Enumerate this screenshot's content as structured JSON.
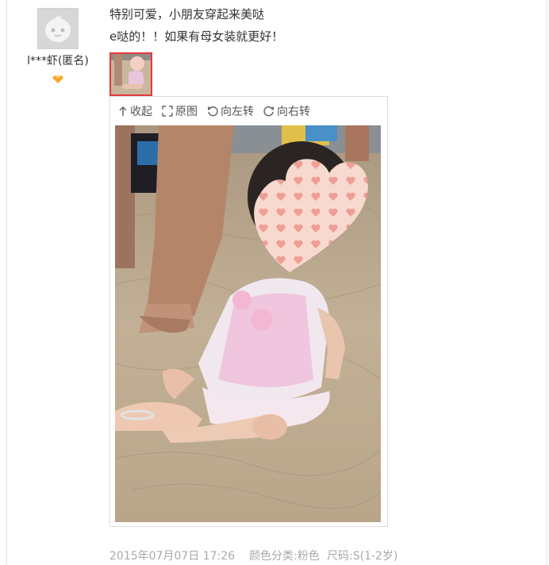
{
  "reviewer": {
    "name": "l***虾(匿名)",
    "level_icon": "diamond-icon",
    "level_color": "#f5a623"
  },
  "review": {
    "line1": "特别可爱，小朋友穿起来美哒",
    "line2": "e哒的！！如果有母女装就更好！"
  },
  "viewer": {
    "toolbar": {
      "collapse": "收起",
      "original": "原图",
      "rotate_left": "向左转",
      "rotate_right": "向右转"
    }
  },
  "meta": {
    "date": "2015年07月07日 17:26",
    "color": "颜色分类:粉色",
    "size": "尺码:S(1-2岁)"
  },
  "colors": {
    "accent": "#e4393c",
    "muted": "#a9a9a9"
  }
}
